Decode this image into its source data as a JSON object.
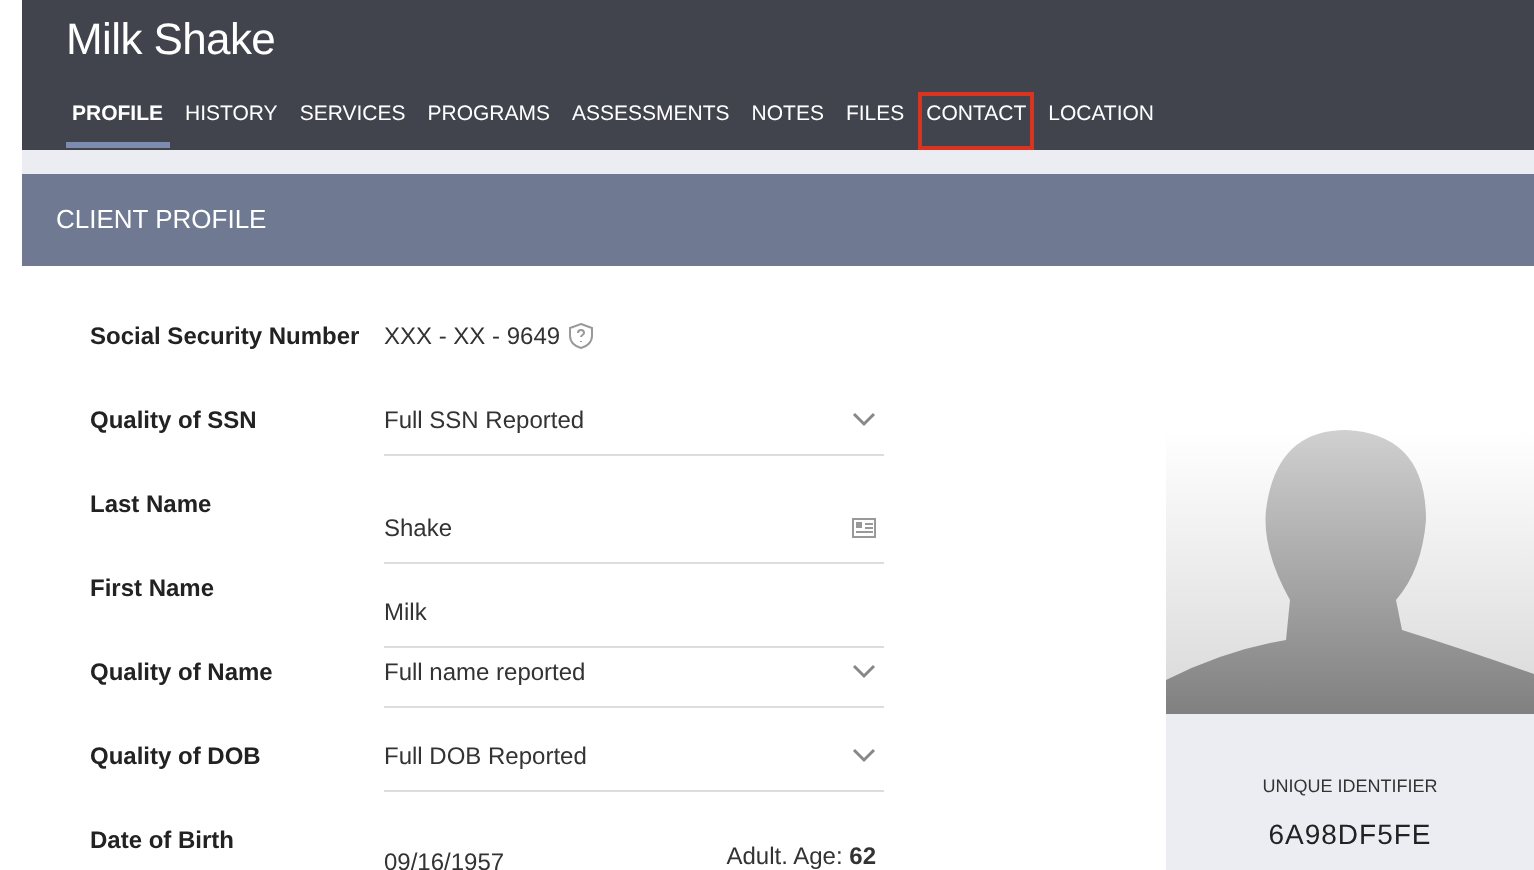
{
  "header": {
    "title": "Milk Shake"
  },
  "tabs": [
    {
      "label": "PROFILE",
      "selected": true,
      "highlighted": false
    },
    {
      "label": "HISTORY",
      "selected": false,
      "highlighted": false
    },
    {
      "label": "SERVICES",
      "selected": false,
      "highlighted": false
    },
    {
      "label": "PROGRAMS",
      "selected": false,
      "highlighted": false
    },
    {
      "label": "ASSESSMENTS",
      "selected": false,
      "highlighted": false
    },
    {
      "label": "NOTES",
      "selected": false,
      "highlighted": false
    },
    {
      "label": "FILES",
      "selected": false,
      "highlighted": false
    },
    {
      "label": "CONTACT",
      "selected": false,
      "highlighted": true
    },
    {
      "label": "LOCATION",
      "selected": false,
      "highlighted": false
    }
  ],
  "section": {
    "title": "CLIENT PROFILE"
  },
  "fields": [
    {
      "label": "Social Security Number",
      "kind": "masked",
      "value": "XXX - XX - 9649"
    },
    {
      "label": "Quality of SSN",
      "kind": "select",
      "value": "Full SSN Reported"
    },
    {
      "label": "Last Name",
      "kind": "card_input",
      "value": "Shake"
    },
    {
      "label": "First Name",
      "kind": "input",
      "value": "Milk"
    },
    {
      "label": "Quality of Name",
      "kind": "select",
      "value": "Full name reported"
    },
    {
      "label": "Quality of DOB",
      "kind": "select",
      "value": "Full DOB Reported"
    },
    {
      "label": "Date of Birth",
      "kind": "date",
      "value": "09/16/1957",
      "note": "Adult. Age: **62**"
    }
  ],
  "identifier": {
    "label": "UNIQUE IDENTIFIER",
    "value": "6A98DF5FE"
  }
}
